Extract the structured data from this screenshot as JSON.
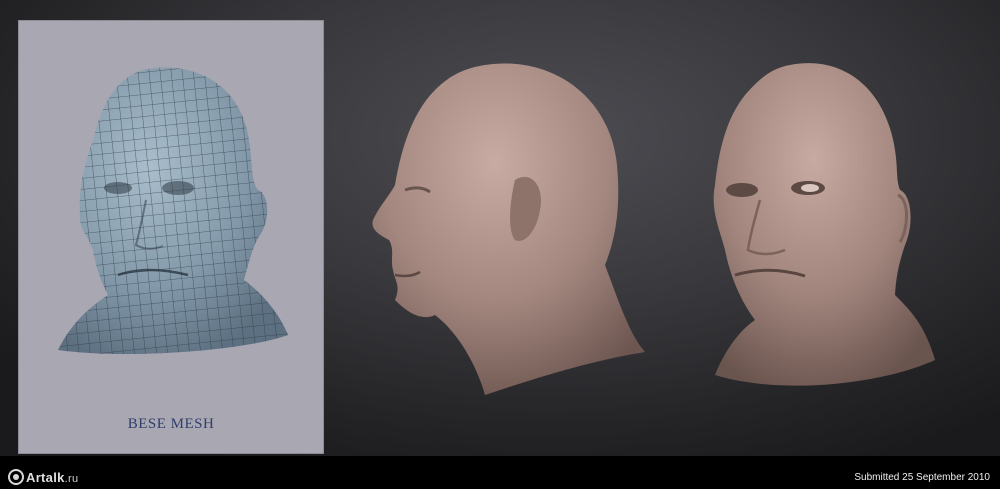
{
  "mesh_panel": {
    "caption": "BESE MESH"
  },
  "footer": {
    "logo_text": "Artalk",
    "logo_domain": ".ru",
    "submitted": "Submitted 25 September 2010"
  },
  "colors": {
    "mesh_panel_bg": "#a9a7b1",
    "mesh_skin": "#8ea3b3",
    "clay_skin": "#a58a82",
    "caption": "#2f3e6b"
  }
}
